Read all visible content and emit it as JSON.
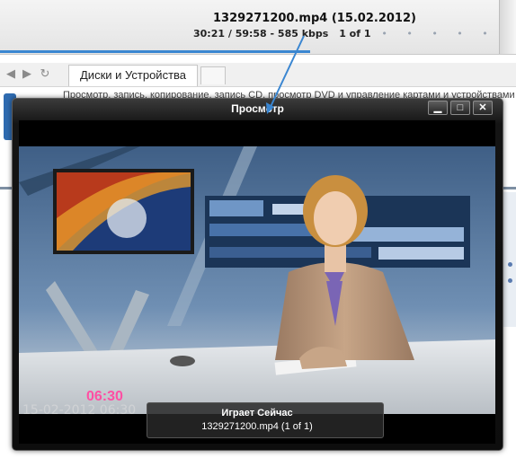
{
  "media_bar": {
    "title": "1329271200.mp4 (15.02.2012)",
    "status": "30:21 / 59:58 - 585 kbps",
    "position": "1 of 1",
    "dots": "• • • • •"
  },
  "explorer": {
    "back_icon": "back-arrow-icon",
    "forward_icon": "forward-arrow-icon",
    "refresh_icon": "refresh-icon",
    "active_tab": "Диски и Устройства",
    "description": "Просмотр, запись, копирование, запись CD, просмотр DVD и управление картами и устройствами"
  },
  "preview": {
    "title": "Просмотр",
    "minimize_icon": "minimize-icon",
    "maximize_icon": "maximize-icon",
    "close_icon": "close-icon",
    "clock": "06:30",
    "timestamp_overlay": "15-02-2012 06:30",
    "now_playing_label": "Играет Сейчас",
    "now_playing_file": "1329271200.mp4 (1 of 1)"
  },
  "colors": {
    "accent_blue": "#3a86d1",
    "window_bg": "#0d0d0d",
    "clock_pink": "#ff4fa3"
  }
}
